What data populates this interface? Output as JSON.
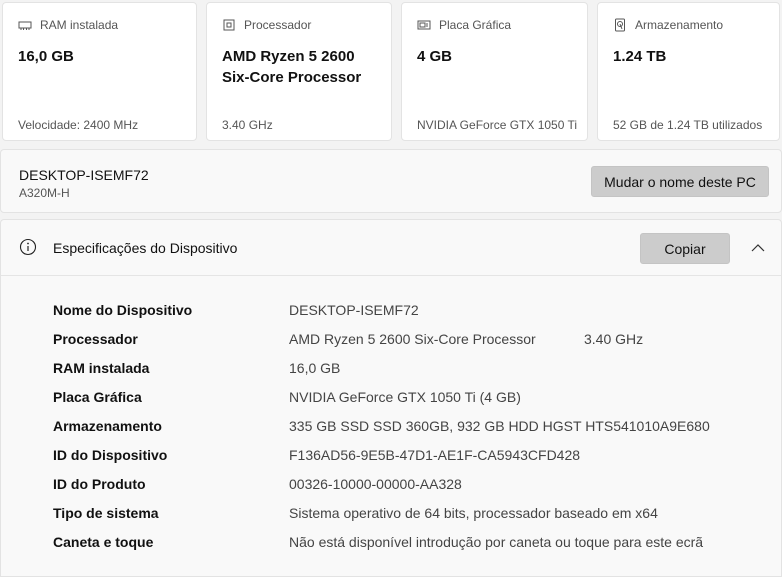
{
  "cards": [
    {
      "icon": "ram-icon",
      "title": "RAM instalada",
      "value": "16,0 GB",
      "footer": "Velocidade: 2400 MHz"
    },
    {
      "icon": "processor-icon",
      "title": "Processador",
      "value": "AMD Ryzen 5 2600\nSix-Core Processor",
      "footer": "3.40 GHz"
    },
    {
      "icon": "graphics-card-icon",
      "title": "Placa Gráfica",
      "value": "4 GB",
      "footer": "NVIDIA GeForce GTX 1050 Ti"
    },
    {
      "icon": "storage-icon",
      "title": "Armazenamento",
      "value": "1.24 TB",
      "footer": "52 GB de 1.24 TB utilizados"
    }
  ],
  "pc": {
    "name": "DESKTOP-ISEMF72",
    "model": "A320M-H",
    "rename_label": "Mudar o nome deste PC"
  },
  "specs": {
    "title": "Especificações do Dispositivo",
    "copy_label": "Copiar",
    "rows": [
      {
        "label": "Nome do Dispositivo",
        "value": "DESKTOP-ISEMF72"
      },
      {
        "label": "Processador",
        "value": "AMD Ryzen 5 2600 Six-Core Processor",
        "extra": "3.40 GHz"
      },
      {
        "label": "RAM instalada",
        "value": "16,0 GB"
      },
      {
        "label": "Placa Gráfica",
        "value": "NVIDIA GeForce GTX 1050 Ti (4 GB)"
      },
      {
        "label": "Armazenamento",
        "value": "335 GB SSD SSD 360GB, 932 GB HDD HGST HTS541010A9E680"
      },
      {
        "label": "ID do Dispositivo",
        "value": "F136AD56-9E5B-47D1-AE1F-CA5943CFD428"
      },
      {
        "label": "ID do Produto",
        "value": "00326-10000-00000-AA328"
      },
      {
        "label": "Tipo de sistema",
        "value": "Sistema operativo de 64 bits, processador baseado em x64"
      },
      {
        "label": "Caneta e toque",
        "value": "Não está disponível introdução por caneta ou toque para este ecrã"
      }
    ]
  }
}
